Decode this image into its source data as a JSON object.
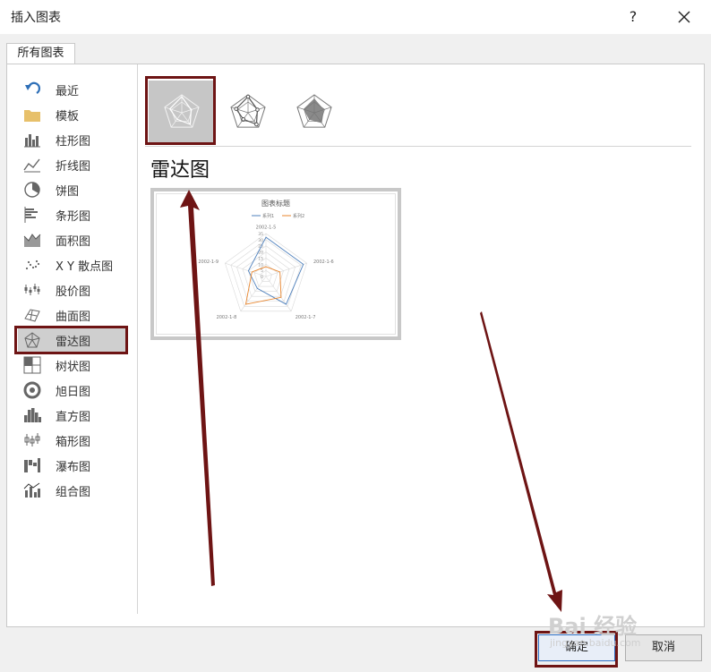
{
  "dialog": {
    "title": "插入图表",
    "help_label": "?",
    "tab": "所有图表"
  },
  "sidebar": {
    "items": [
      {
        "label": "最近",
        "icon": "undo-icon"
      },
      {
        "label": "模板",
        "icon": "folder-icon"
      },
      {
        "label": "柱形图",
        "icon": "column-chart-icon"
      },
      {
        "label": "折线图",
        "icon": "line-chart-icon"
      },
      {
        "label": "饼图",
        "icon": "pie-chart-icon"
      },
      {
        "label": "条形图",
        "icon": "bar-chart-icon"
      },
      {
        "label": "面积图",
        "icon": "area-chart-icon"
      },
      {
        "label": "X Y 散点图",
        "icon": "scatter-chart-icon"
      },
      {
        "label": "股价图",
        "icon": "stock-chart-icon"
      },
      {
        "label": "曲面图",
        "icon": "surface-chart-icon"
      },
      {
        "label": "雷达图",
        "icon": "radar-chart-icon",
        "selected": true
      },
      {
        "label": "树状图",
        "icon": "treemap-chart-icon"
      },
      {
        "label": "旭日图",
        "icon": "sunburst-chart-icon"
      },
      {
        "label": "直方图",
        "icon": "histogram-chart-icon"
      },
      {
        "label": "箱形图",
        "icon": "box-whisker-chart-icon"
      },
      {
        "label": "瀑布图",
        "icon": "waterfall-chart-icon"
      },
      {
        "label": "组合图",
        "icon": "combo-chart-icon"
      }
    ]
  },
  "subtypes": [
    {
      "icon": "radar-icon",
      "selected": true
    },
    {
      "icon": "radar-markers-icon",
      "selected": false
    },
    {
      "icon": "filled-radar-icon",
      "selected": false
    }
  ],
  "chart_heading": "雷达图",
  "preview": {
    "chart_data": {
      "type": "radar",
      "title": "图表标题",
      "categories": [
        "2002-1-5",
        "2002-1-6",
        "2002-1-7",
        "2002-1-8",
        "2002-1-9"
      ],
      "series": [
        {
          "name": "系列1",
          "values": [
            32,
            32,
            28,
            12,
            15
          ]
        },
        {
          "name": "系列2",
          "values": [
            8,
            12,
            21,
            28,
            12
          ]
        }
      ],
      "rlim": [
        0,
        35
      ],
      "ticks": [
        0,
        5,
        10,
        15,
        20,
        25,
        30,
        35
      ],
      "colors": [
        "#4f81bd",
        "#e8852d"
      ],
      "legend": "top"
    }
  },
  "buttons": {
    "ok": "确定",
    "cancel": "取消"
  },
  "watermark": {
    "main": "Bai 经验",
    "sub": "jingyan.baidu.com"
  },
  "colors": {
    "highlight": "#6e1414",
    "selection": "#cfcfcf"
  }
}
